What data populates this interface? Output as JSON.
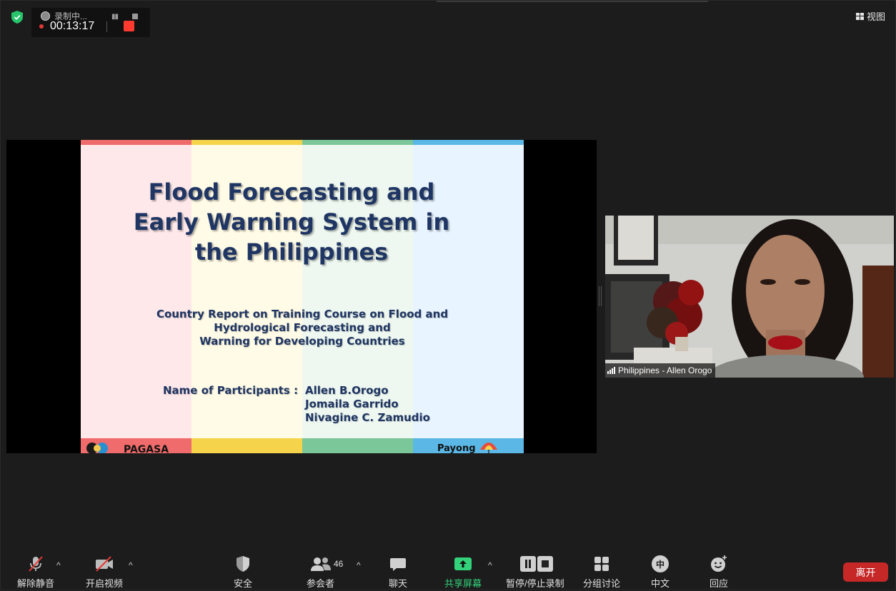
{
  "recording": {
    "status": "录制中...",
    "time": "00:13:17"
  },
  "view_button": {
    "label": "视图"
  },
  "slide": {
    "title": "Flood  Forecasting and\nEarly Warning System in\nthe Philippines",
    "subtitle": "Country Report on Training Course on Flood and\nHydrological Forecasting and\nWarning for Developing Countries",
    "participants_label": "Name of Participants :",
    "participants": [
      "Allen B.Orogo",
      "Jomaila Garrido",
      "Nivagine C. Zamudio"
    ],
    "logo_left_text": "PAGASA",
    "logo_right_text": "Payong"
  },
  "video": {
    "participant_name": "Philippines - Allen Orogo"
  },
  "toolbar": {
    "unmute": "解除静音",
    "start_video": "开启视频",
    "security": "安全",
    "participants": "参会者",
    "participants_count": "46",
    "chat": "聊天",
    "share_screen": "共享屏幕",
    "pause_stop_record": "暂停/停止录制",
    "breakout": "分组讨论",
    "language": "中文",
    "language_icon_text": "中",
    "reactions": "回应",
    "leave": "离开"
  },
  "colors": {
    "accent_green": "#33d17a",
    "leave_red": "#c62828",
    "record_red": "#ff3b30",
    "slide_title": "#1f3563"
  }
}
